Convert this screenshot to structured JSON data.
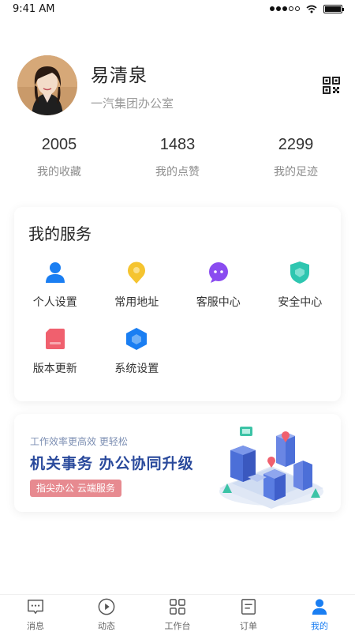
{
  "status_bar": {
    "time": "9:41 AM"
  },
  "profile": {
    "name": "易清泉",
    "org": "一汽集团办公室"
  },
  "stats": [
    {
      "value": "2005",
      "label": "我的收藏"
    },
    {
      "value": "1483",
      "label": "我的点赞"
    },
    {
      "value": "2299",
      "label": "我的足迹"
    }
  ],
  "services": {
    "title": "我的服务",
    "items": [
      {
        "label": "个人设置",
        "icon": "person-icon",
        "color": "#1a7ef2"
      },
      {
        "label": "常用地址",
        "icon": "location-pin-icon",
        "color": "#f5c430"
      },
      {
        "label": "客服中心",
        "icon": "chat-bubble-icon",
        "color": "#8a4cf0"
      },
      {
        "label": "安全中心",
        "icon": "shield-icon",
        "color": "#2ec6b0"
      },
      {
        "label": "版本更新",
        "icon": "sd-card-icon",
        "color": "#f0606e"
      },
      {
        "label": "系统设置",
        "icon": "hexagon-icon",
        "color": "#1a7ef2"
      }
    ]
  },
  "banner": {
    "subtitle": "工作效率更高效 更轻松",
    "title": "机关事务 办公协同升级",
    "tag": "指尖办公 云端服务"
  },
  "tabs": [
    {
      "label": "消息",
      "icon": "message-icon"
    },
    {
      "label": "动态",
      "icon": "play-circle-icon"
    },
    {
      "label": "工作台",
      "icon": "grid-icon"
    },
    {
      "label": "订单",
      "icon": "document-icon"
    },
    {
      "label": "我的",
      "icon": "user-icon",
      "active": true
    }
  ],
  "colors": {
    "accent": "#1a7ef2",
    "banner_title": "#2a4a9c",
    "banner_tag": "#e78a90"
  }
}
